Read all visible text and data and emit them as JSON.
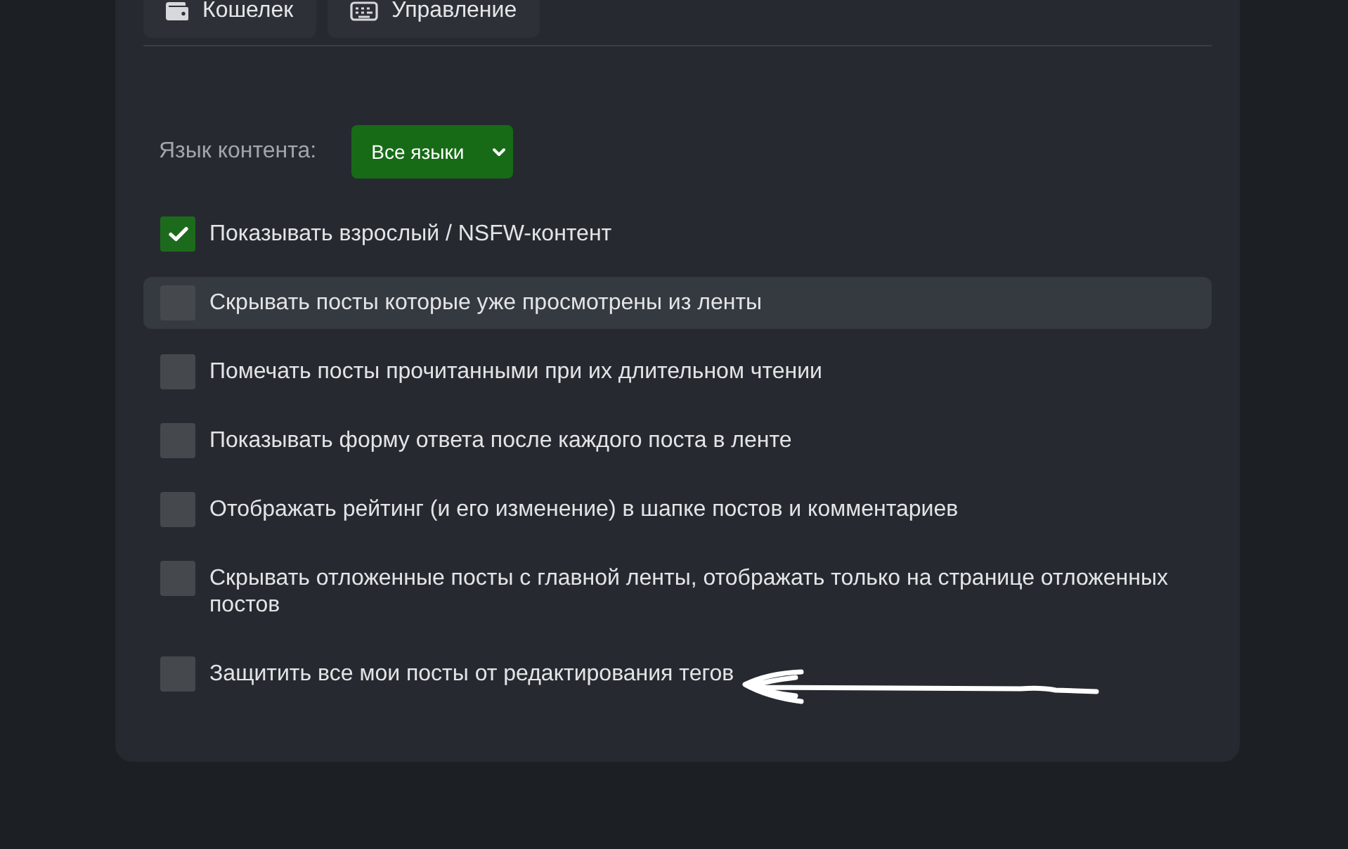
{
  "nav_buttons": [
    {
      "label": "Кошелек"
    },
    {
      "label": "Управление"
    }
  ],
  "content_language": {
    "label": "Язык контента:",
    "value": "Все языки"
  },
  "options": [
    {
      "label": "Показывать взрослый / NSFW-контент",
      "checked": true,
      "highlighted": false
    },
    {
      "label": "Скрывать посты которые уже просмотрены из ленты",
      "checked": false,
      "highlighted": true
    },
    {
      "label": "Помечать посты прочитанными при их длительном чтении",
      "checked": false,
      "highlighted": false
    },
    {
      "label": "Показывать форму ответа после каждого поста в ленте",
      "checked": false,
      "highlighted": false
    },
    {
      "label": "Отображать рейтинг (и его изменение) в шапке постов и комментариев",
      "checked": false,
      "highlighted": false
    },
    {
      "label": "Скрывать отложенные посты с главной ленты, отображать только на странице отложенных постов",
      "checked": false,
      "highlighted": false
    },
    {
      "label": "Защитить все мои посты от редактирования тегов",
      "checked": false,
      "highlighted": false
    }
  ]
}
